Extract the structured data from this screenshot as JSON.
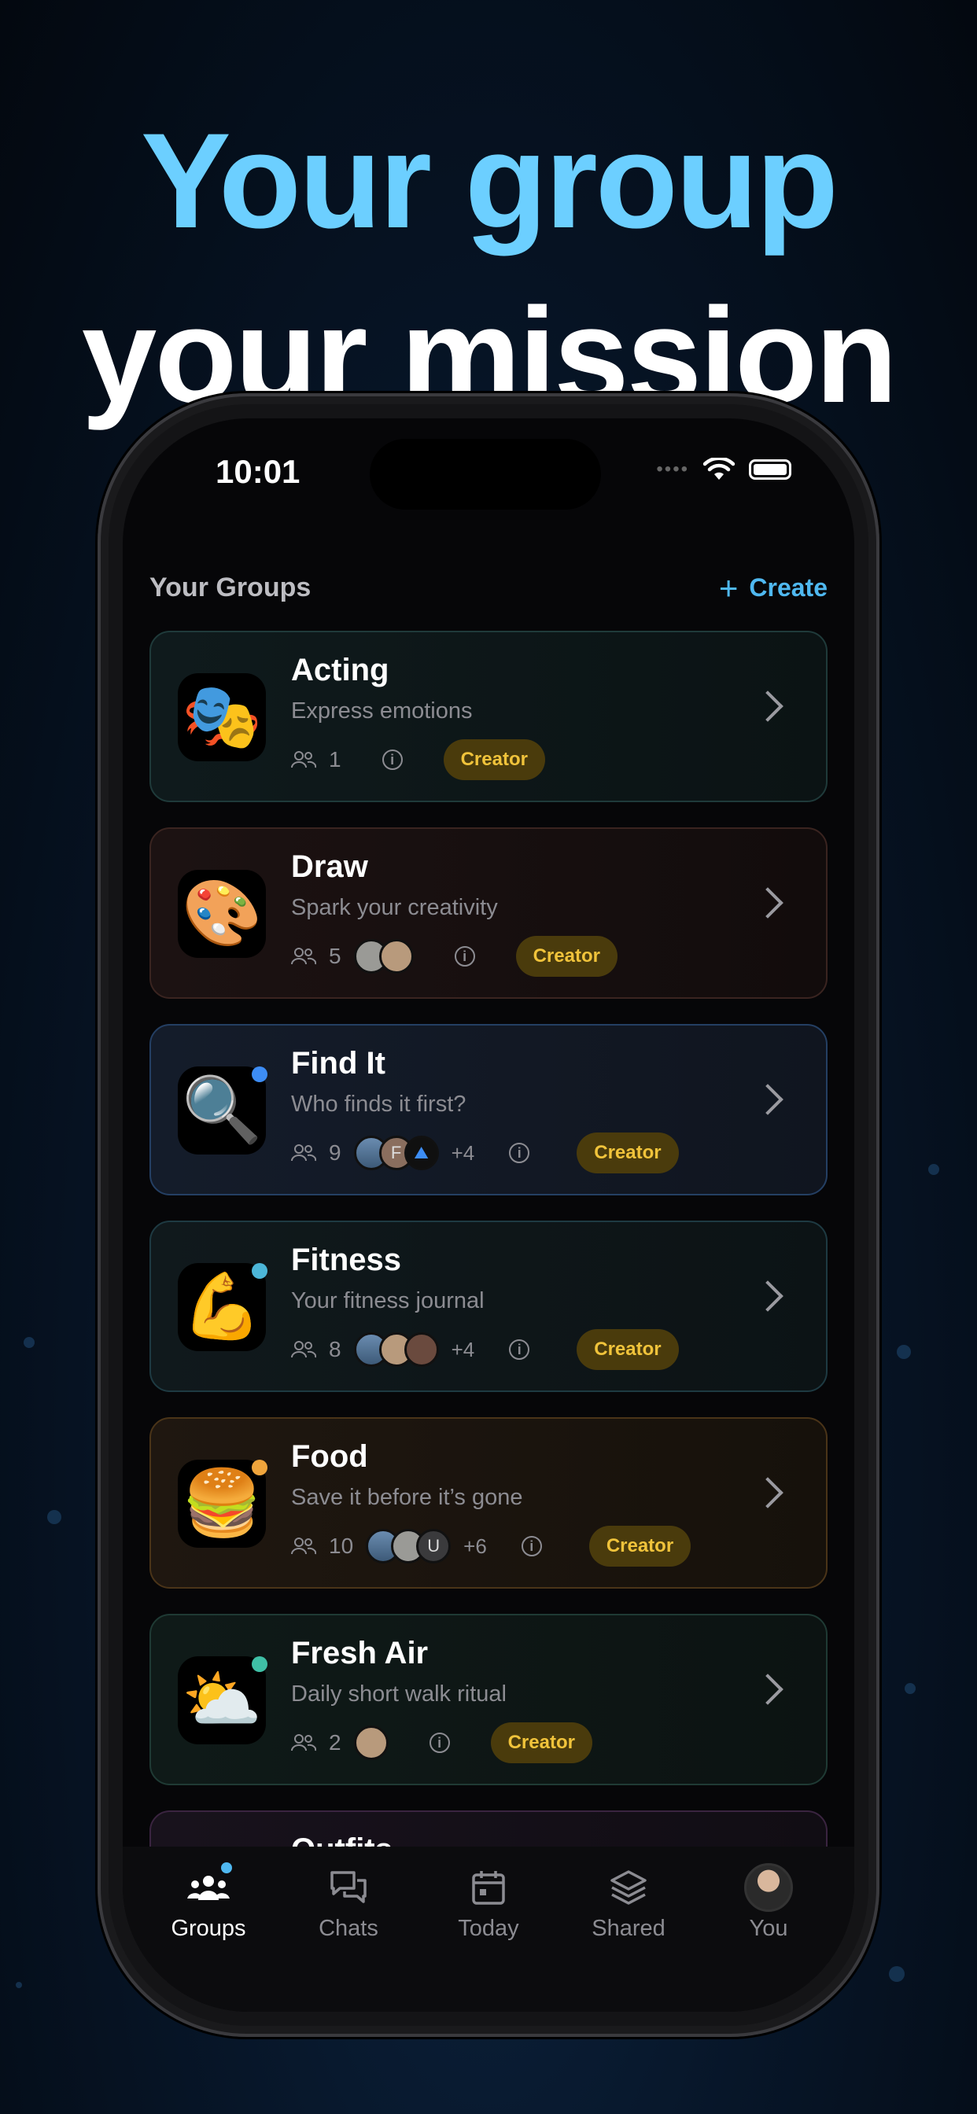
{
  "headline": {
    "line1": "Your group",
    "line2": "your mission"
  },
  "status_bar": {
    "time": "10:01"
  },
  "section": {
    "title": "Your Groups",
    "create_label": "Create"
  },
  "groups": [
    {
      "name": "Acting",
      "description": "Express emotions",
      "members": "1",
      "extra": "",
      "badge": "Creator",
      "emoji": "🎭",
      "accent": "#1f3a3a",
      "dot": ""
    },
    {
      "name": "Draw",
      "description": "Spark your creativity",
      "members": "5",
      "extra": "",
      "badge": "Creator",
      "emoji": "🎨",
      "accent": "#3a2420",
      "dot": ""
    },
    {
      "name": "Find It",
      "description": "Who finds it first?",
      "members": "9",
      "extra": "+4",
      "badge": "Creator",
      "emoji": "🔍",
      "accent": "#243f63",
      "dot": "#3d8df5"
    },
    {
      "name": "Fitness",
      "description": "Your fitness journal",
      "members": "8",
      "extra": "+4",
      "badge": "Creator",
      "emoji": "💪",
      "accent": "#1e3a42",
      "dot": "#4cb6d8"
    },
    {
      "name": "Food",
      "description": "Save it before it’s gone",
      "members": "10",
      "extra": "+6",
      "badge": "Creator",
      "emoji": "🍔",
      "accent": "#4a3418",
      "dot": "#f0a53c"
    },
    {
      "name": "Fresh Air",
      "description": "Daily short walk ritual",
      "members": "2",
      "extra": "",
      "badge": "Creator",
      "emoji": "⛅",
      "accent": "#1f3a34",
      "dot": "#3fc0a6"
    },
    {
      "name": "Outfits",
      "description": "",
      "members": "",
      "extra": "",
      "badge": "",
      "emoji": "",
      "accent": "#3a2440",
      "dot": ""
    }
  ],
  "avatar_letters": {
    "find_it": "F",
    "food": "U"
  },
  "tabs": [
    {
      "label": "Groups",
      "icon": "groups-icon",
      "active": true
    },
    {
      "label": "Chats",
      "icon": "chats-icon"
    },
    {
      "label": "Today",
      "icon": "calendar-icon"
    },
    {
      "label": "Shared",
      "icon": "layers-icon"
    },
    {
      "label": "You",
      "icon": "profile-avatar"
    }
  ]
}
